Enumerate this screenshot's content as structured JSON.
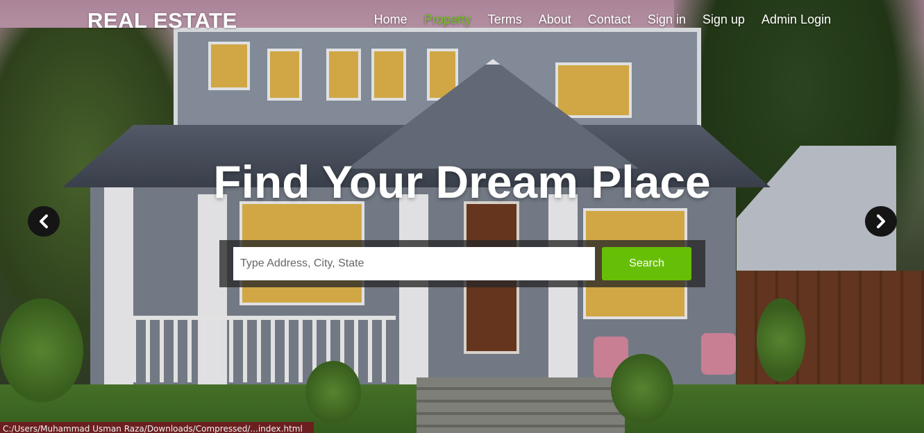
{
  "brand": "REAL ESTATE",
  "nav": {
    "items": [
      {
        "label": "Home",
        "active": false
      },
      {
        "label": "Property",
        "active": true
      },
      {
        "label": "Terms",
        "active": false
      },
      {
        "label": "About",
        "active": false
      },
      {
        "label": "Contact",
        "active": false
      },
      {
        "label": "Sign in",
        "active": false
      },
      {
        "label": "Sign up",
        "active": false
      },
      {
        "label": "Admin Login",
        "active": false
      }
    ],
    "active_color": "#6cc317"
  },
  "hero": {
    "headline": "Find Your Dream Place",
    "prev_icon": "chevron-left-icon",
    "next_icon": "chevron-right-icon"
  },
  "search": {
    "placeholder": "Type Address, City, State",
    "value": "",
    "button_label": "Search",
    "button_color": "#66bf06"
  },
  "status_bar": {
    "text": "C:/Users/Muhammad Usman Raza/Downloads/Compressed/...index.html"
  }
}
